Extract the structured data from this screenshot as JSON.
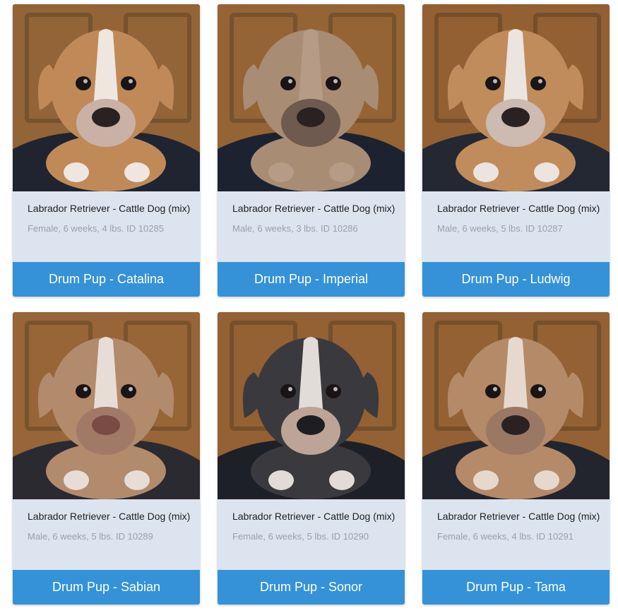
{
  "puppies": [
    {
      "breed": "Labrador Retriever - Cattle Dog (mix)",
      "details": "Female, 6 weeks, 4 lbs. ID 10285",
      "name": "Drum Pup - Catalina",
      "photo": {
        "wood": "#8a5a2c",
        "sleeve": "#1f2430",
        "coat": "#c08a58",
        "white": "#efe6e0",
        "muzzle": "#c9b1a6",
        "nose": "#2a2222"
      }
    },
    {
      "breed": "Labrador Retriever - Cattle Dog (mix)",
      "details": "Male, 6 weeks, 3 lbs. ID 10286",
      "name": "Drum Pup - Imperial",
      "photo": {
        "wood": "#8c5a2a",
        "sleeve": "#1c2230",
        "coat": "#a88c74",
        "white": "#b69c86",
        "muzzle": "#6e5a4e",
        "nose": "#2a2222"
      }
    },
    {
      "breed": "Labrador Retriever - Cattle Dog (mix)",
      "details": "Male, 6 weeks, 5 lbs. ID 10287",
      "name": "Drum Pup - Ludwig",
      "photo": {
        "wood": "#8a5528",
        "sleeve": "#232833",
        "coat": "#c08c5c",
        "white": "#ece4de",
        "muzzle": "#cdbab0",
        "nose": "#2a2222"
      }
    },
    {
      "breed": "Labrador Retriever - Cattle Dog (mix)",
      "details": "Male, 6 weeks, 5 lbs. ID 10289",
      "name": "Drum Pup - Sabian",
      "photo": {
        "wood": "#8f5b2c",
        "sleeve": "#2a2a30",
        "coat": "#b28a6c",
        "white": "#e8ddd6",
        "muzzle": "#a07a66",
        "nose": "#7a4a44"
      }
    },
    {
      "breed": "Labrador Retriever - Cattle Dog (mix)",
      "details": "Female, 6 weeks, 5 lbs. ID 10290",
      "name": "Drum Pup - Sonor",
      "photo": {
        "wood": "#8a5628",
        "sleeve": "#1e2028",
        "coat": "#3a3a3e",
        "white": "#e2dcd8",
        "muzzle": "#bca596",
        "nose": "#1e1e22"
      }
    },
    {
      "breed": "Labrador Retriever - Cattle Dog (mix)",
      "details": "Female, 6 weeks, 4 lbs. ID 10291",
      "name": "Drum Pup - Tama",
      "photo": {
        "wood": "#8a5628",
        "sleeve": "#22252d",
        "coat": "#b48a68",
        "white": "#e6d8cc",
        "muzzle": "#9a7864",
        "nose": "#2a2222"
      }
    }
  ],
  "colors": {
    "button": "#3592d8",
    "info_bg": "#dce4f0",
    "breed_text": "#222222",
    "detail_text": "#9aa1aa"
  }
}
